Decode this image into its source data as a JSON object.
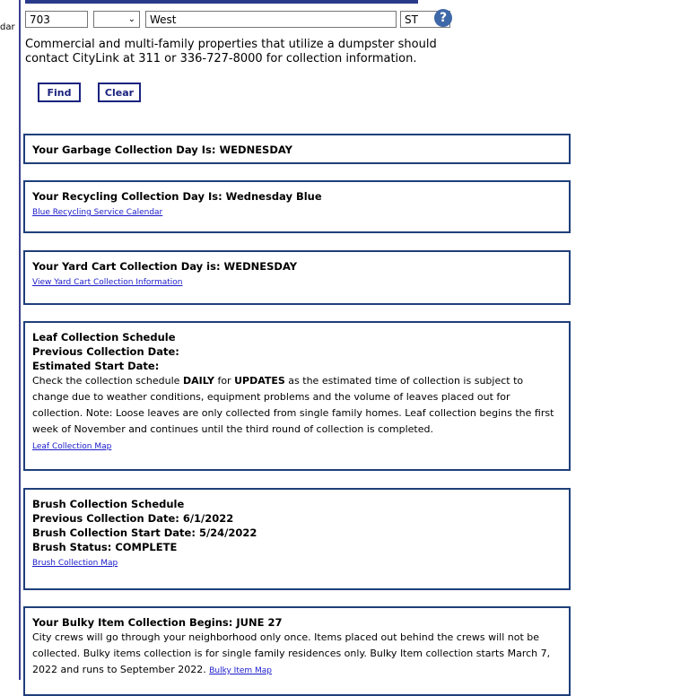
{
  "left_fragment": "dar",
  "form": {
    "number_value": "703",
    "direction_value": "",
    "street_value": "West",
    "type_value": "ST"
  },
  "notice": "Commercial and multi-family properties that utilize a dumpster should contact CityLink at 311 or 336-727-8000 for collection information.",
  "buttons": {
    "find": "Find",
    "clear": "Clear"
  },
  "garbage": {
    "title": "Your Garbage Collection Day Is: WEDNESDAY"
  },
  "recycling": {
    "title": "Your Recycling Collection Day Is: Wednesday Blue",
    "link": "Blue Recycling Service Calendar"
  },
  "yard": {
    "title": "Your Yard Cart Collection Day is: WEDNESDAY",
    "link": "View Yard Cart Collection Information"
  },
  "leaf": {
    "title": "Leaf Collection Schedule",
    "previous": "Previous Collection Date:",
    "estimated": "Estimated Start Date:",
    "text_before_daily": "Check the collection schedule ",
    "daily": "DAILY",
    "text_for": " for ",
    "updates": "UPDATES",
    "text_after": " as the estimated time of collection is subject to change due to weather conditions, equipment problems and the volume of leaves placed out for collection. Note: Loose leaves are only collected from single family homes. Leaf collection begins the first week of November and continues until the third round of collection is completed.",
    "link": "Leaf Collection Map"
  },
  "brush": {
    "title": "Brush Collection Schedule",
    "previous": "Previous Collection Date: 6/1/2022",
    "start": "Brush Collection Start Date: 5/24/2022",
    "status": "Brush Status: COMPLETE",
    "link": "Brush Collection Map"
  },
  "bulky": {
    "title": "Your Bulky Item Collection Begins: JUNE 27",
    "text": "City crews will go through your neighborhood only once. Items placed out behind the crews will not be collected. Bulky items collection is for single family residences only. Bulky Item collection starts March 7, 2022 and runs to September 2022. ",
    "link": "Bulky Item Map"
  }
}
